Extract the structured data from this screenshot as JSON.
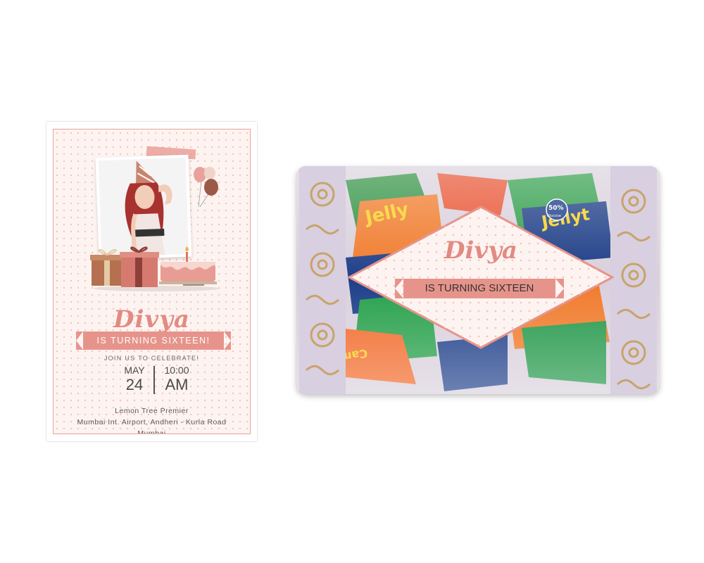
{
  "invitation": {
    "name": "Divya",
    "ribbon": "IS TURNING SIXTEEN!",
    "join": "JOIN US TO CELEBRATE!",
    "month": "MAY",
    "day": "24",
    "time": "10:00",
    "ampm": "AM",
    "venue_line1": "Lemon Tree Premier",
    "venue_line2": "Mumbai Int. Airport, Andheri - Kurla Road",
    "venue_line3": "Mumbai"
  },
  "candy_pack": {
    "name": "Divya",
    "ribbon": "IS TURNING SIXTEEN",
    "wrapper_brand_1": "Jelly",
    "wrapper_brand_2": "Jellyt",
    "wrapper_badge": "50%",
    "wrapper_badge_sub": "Glucose",
    "wrapper_mark": "Camya"
  },
  "colors": {
    "accent": "#e28b83",
    "ribbon": "#e6948b",
    "card_bg": "#fdf4f1",
    "gold": "#c9a36a"
  }
}
